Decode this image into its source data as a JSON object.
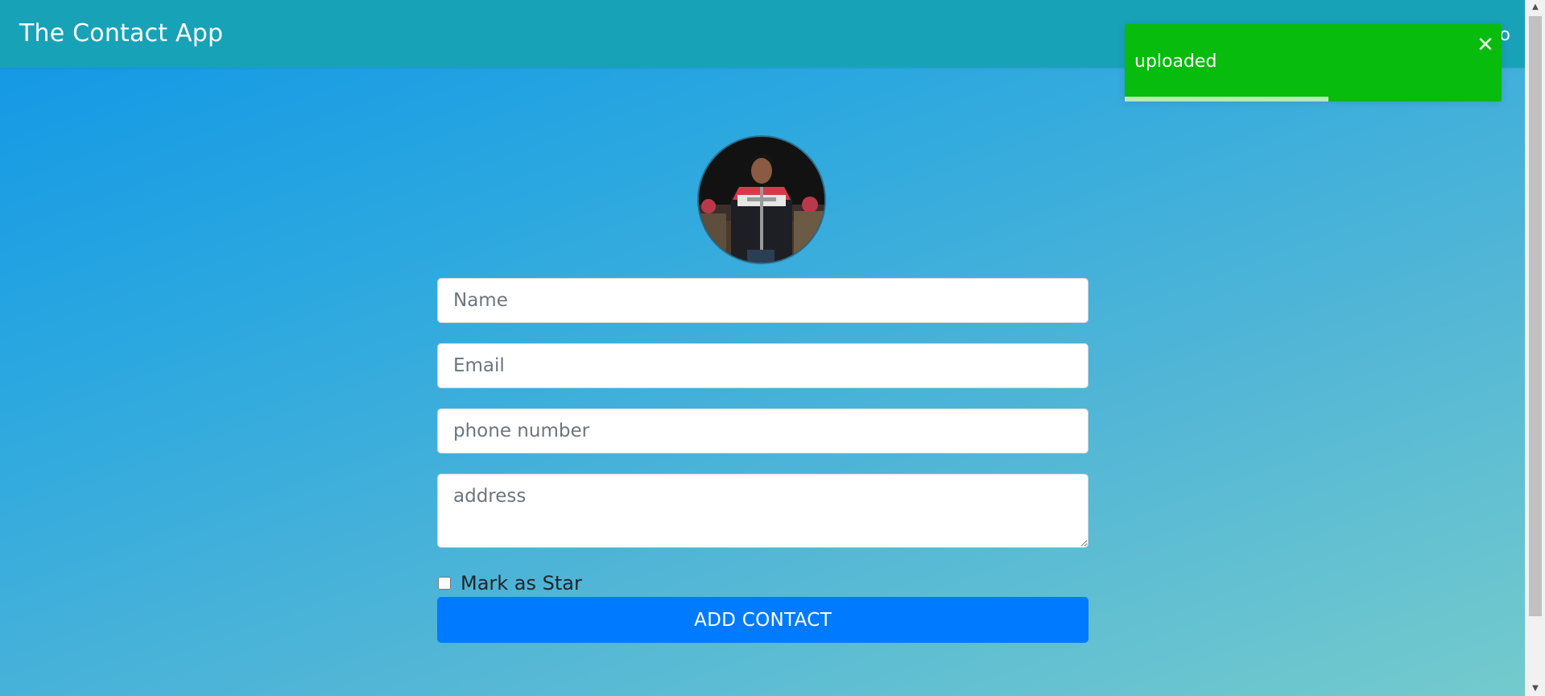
{
  "navbar": {
    "brand": "The Contact App",
    "right_text": "o"
  },
  "form": {
    "avatar_alt": "contact photo",
    "name_placeholder": "Name",
    "name_value": "",
    "email_placeholder": "Email",
    "email_value": "",
    "phone_placeholder": "phone number",
    "phone_value": "",
    "address_placeholder": "address",
    "address_value": "",
    "star_label": "Mark as Star",
    "star_checked": false,
    "submit_label": "ADD CONTACT"
  },
  "toast": {
    "message": "uploaded",
    "close_icon": "close-icon",
    "progress": 0.54,
    "color": "#07bc0c"
  },
  "colors": {
    "navbar": "#18a2b8",
    "primary_button": "#007bff"
  }
}
